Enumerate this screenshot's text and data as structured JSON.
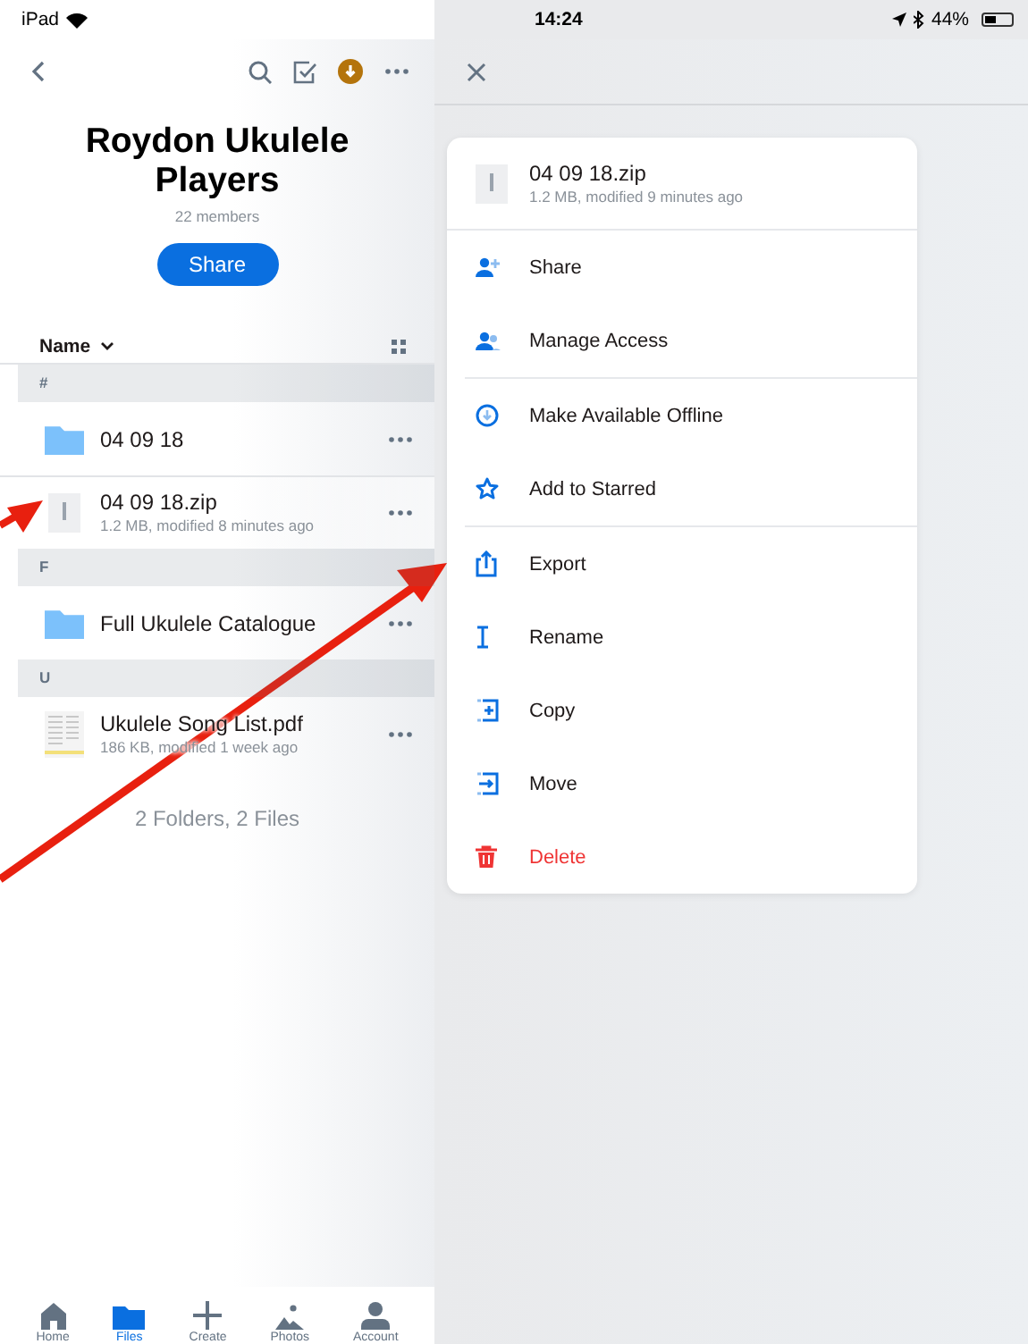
{
  "status_bar": {
    "device": "iPad",
    "time": "14:24",
    "battery": "44%"
  },
  "folder": {
    "title": "Roydon Ukulele Players",
    "members": "22 members",
    "share_button": "Share"
  },
  "sort": {
    "label": "Name"
  },
  "sections": [
    {
      "header": "#",
      "items": [
        {
          "kind": "folder",
          "name": "04 09 18",
          "selected": false
        },
        {
          "kind": "zip",
          "name": "04 09 18.zip",
          "detail": "1.2 MB, modified 8 minutes ago",
          "selected": true
        }
      ]
    },
    {
      "header": "F",
      "items": [
        {
          "kind": "folder",
          "name": "Full Ukulele Catalogue",
          "selected": false
        }
      ]
    },
    {
      "header": "U",
      "items": [
        {
          "kind": "pdf",
          "name": "Ukulele Song List.pdf",
          "detail": "186 KB, modified 1 week ago",
          "selected": false
        }
      ]
    }
  ],
  "summary": "2 Folders, 2 Files",
  "menu": {
    "file": {
      "name": "04 09 18.zip",
      "detail": "1.2 MB, modified 9 minutes ago"
    },
    "groups": [
      [
        {
          "label": "Share",
          "kind": "share"
        },
        {
          "label": "Manage Access",
          "kind": "access"
        }
      ],
      [
        {
          "label": "Make Available Offline",
          "kind": "offline"
        },
        {
          "label": "Add to Starred",
          "kind": "star"
        }
      ],
      [
        {
          "label": "Export",
          "kind": "export"
        },
        {
          "label": "Rename",
          "kind": "rename"
        },
        {
          "label": "Copy",
          "kind": "copy"
        },
        {
          "label": "Move",
          "kind": "move"
        },
        {
          "label": "Delete",
          "kind": "delete"
        }
      ]
    ]
  },
  "tabs": [
    {
      "kind": "home",
      "label": "Home",
      "selected": false
    },
    {
      "kind": "files",
      "label": "Files",
      "selected": true
    },
    {
      "kind": "create",
      "label": "Create",
      "selected": false
    },
    {
      "kind": "photos",
      "label": "Photos",
      "selected": false
    },
    {
      "kind": "account",
      "label": "Account",
      "selected": false
    }
  ]
}
